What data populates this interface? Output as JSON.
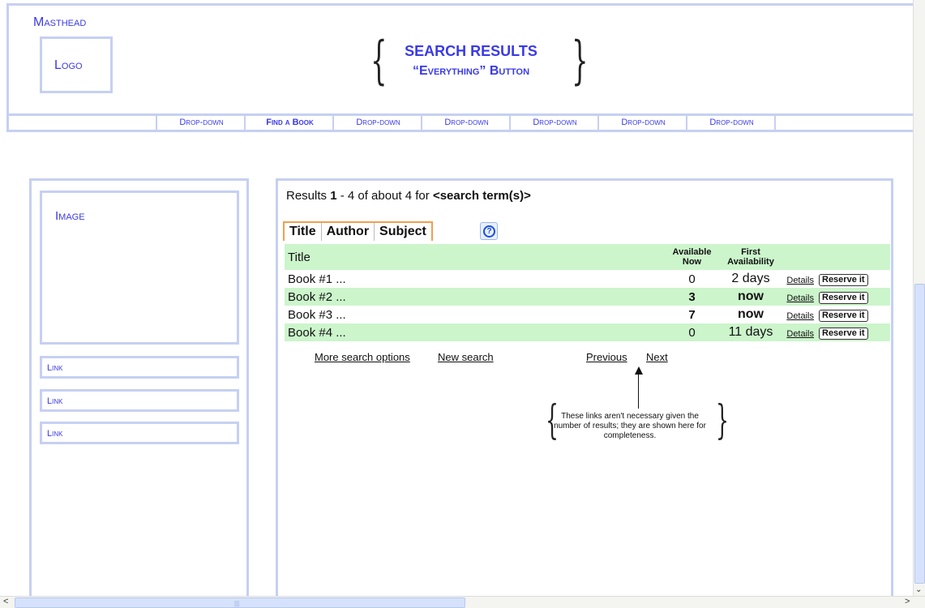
{
  "masthead": {
    "label": "Masthead",
    "logo": "Logo",
    "search_title": "SEARCH RESULTS",
    "search_subtitle": "“Everything” Button"
  },
  "nav": {
    "items": [
      {
        "label": "Drop-down",
        "bold": false
      },
      {
        "label": "Find a Book",
        "bold": true
      },
      {
        "label": "Drop-down",
        "bold": false
      },
      {
        "label": "Drop-down",
        "bold": false
      },
      {
        "label": "Drop-down",
        "bold": false
      },
      {
        "label": "Drop-down",
        "bold": false
      },
      {
        "label": "Drop-down",
        "bold": false
      }
    ]
  },
  "sidebar": {
    "image_label": "Image",
    "links": [
      "Link",
      "Link",
      "Link"
    ]
  },
  "results": {
    "prefix": "Results ",
    "start": "1",
    "range_mid": " - 4 of about 4 for ",
    "term": "<search term(s)>"
  },
  "tabs": [
    "Title",
    "Author",
    "Subject"
  ],
  "table": {
    "header": {
      "title": "Title",
      "available_line1": "Available",
      "available_line2": "Now",
      "first_line1": "First",
      "first_line2": "Availability"
    },
    "rows": [
      {
        "title": "Book #1 ...",
        "available": "0",
        "first": "2 days",
        "available_bold": false,
        "first_bold": false,
        "details": "Details",
        "reserve": "Reserve it"
      },
      {
        "title": "Book #2 ...",
        "available": "3",
        "first": "now",
        "available_bold": true,
        "first_bold": true,
        "details": "Details",
        "reserve": "Reserve it"
      },
      {
        "title": "Book #3 ...",
        "available": "7",
        "first": "now",
        "available_bold": true,
        "first_bold": true,
        "details": "Details",
        "reserve": "Reserve it"
      },
      {
        "title": "Book #4 ...",
        "available": "0",
        "first": "11 days",
        "available_bold": false,
        "first_bold": false,
        "details": "Details",
        "reserve": "Reserve it"
      }
    ]
  },
  "links": {
    "more_options": "More search options",
    "new_search": "New search",
    "previous": "Previous",
    "next": "Next"
  },
  "annotation": "These links aren't necessary given the number of results; they are shown here for completeness.",
  "icons": {
    "help": "help-icon",
    "scroll_left": "arrow-left-icon",
    "scroll_right": "arrow-right-icon",
    "scroll_down": "arrow-down-icon"
  },
  "colors": {
    "wireframe_border": "#c6d0f2",
    "label_blue": "#3a3ae6",
    "row_highlight": "#ccf5cc",
    "tab_border": "#f0a050"
  }
}
